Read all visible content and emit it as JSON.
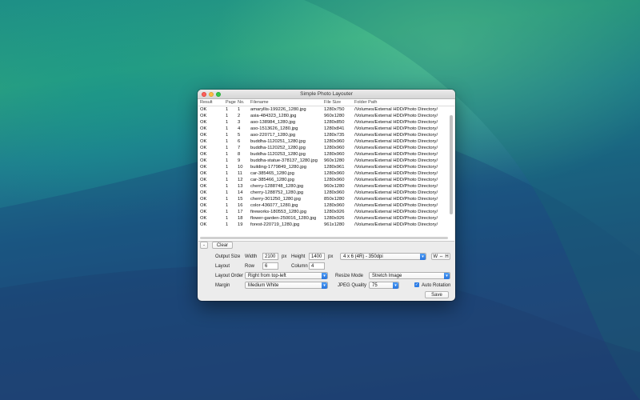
{
  "window": {
    "title": "Simple Photo Layouter"
  },
  "table": {
    "columns": [
      "Result",
      "Page",
      "No.",
      "Filename",
      "File Size",
      "Folder Path"
    ],
    "rows": [
      [
        "OK",
        "1",
        "1",
        "amaryllis-199226_1280.jpg",
        "1280x750",
        "/Volumes/External HDD/Photo Directory/"
      ],
      [
        "OK",
        "1",
        "2",
        "asia-484323_1280.jpg",
        "960x1280",
        "/Volumes/External HDD/Photo Directory/"
      ],
      [
        "OK",
        "1",
        "3",
        "aso-138984_1280.jpg",
        "1280x850",
        "/Volumes/External HDD/Photo Directory/"
      ],
      [
        "OK",
        "1",
        "4",
        "aso-1513626_1280.jpg",
        "1280x841",
        "/Volumes/External HDD/Photo Directory/"
      ],
      [
        "OK",
        "1",
        "5",
        "aso-220717_1280.jpg",
        "1280x735",
        "/Volumes/External HDD/Photo Directory/"
      ],
      [
        "OK",
        "1",
        "6",
        "buddha-1120251_1280.jpg",
        "1280x960",
        "/Volumes/External HDD/Photo Directory/"
      ],
      [
        "OK",
        "1",
        "7",
        "buddha-1120252_1280.jpg",
        "1280x960",
        "/Volumes/External HDD/Photo Directory/"
      ],
      [
        "OK",
        "1",
        "8",
        "buddha-1120253_1280.jpg",
        "1280x960",
        "/Volumes/External HDD/Photo Directory/"
      ],
      [
        "OK",
        "1",
        "9",
        "buddha-statue-378137_1280.jpg",
        "960x1280",
        "/Volumes/External HDD/Photo Directory/"
      ],
      [
        "OK",
        "1",
        "10",
        "building-1779849_1280.jpg",
        "1280x961",
        "/Volumes/External HDD/Photo Directory/"
      ],
      [
        "OK",
        "1",
        "11",
        "car-385465_1280.jpg",
        "1280x960",
        "/Volumes/External HDD/Photo Directory/"
      ],
      [
        "OK",
        "1",
        "12",
        "car-385466_1280.jpg",
        "1280x960",
        "/Volumes/External HDD/Photo Directory/"
      ],
      [
        "OK",
        "1",
        "13",
        "cherry-1288748_1280.jpg",
        "960x1280",
        "/Volumes/External HDD/Photo Directory/"
      ],
      [
        "OK",
        "1",
        "14",
        "cherry-1288752_1280.jpg",
        "1280x960",
        "/Volumes/External HDD/Photo Directory/"
      ],
      [
        "OK",
        "1",
        "15",
        "cherry-301250_1280.jpg",
        "850x1280",
        "/Volumes/External HDD/Photo Directory/"
      ],
      [
        "OK",
        "1",
        "16",
        "color-436077_1280.jpg",
        "1280x960",
        "/Volumes/External HDD/Photo Directory/"
      ],
      [
        "OK",
        "1",
        "17",
        "fireworks-180553_1280.jpg",
        "1280x926",
        "/Volumes/External HDD/Photo Directory/"
      ],
      [
        "OK",
        "1",
        "18",
        "flower-garden-250016_1280.jpg",
        "1280x926",
        "/Volumes/External HDD/Photo Directory/"
      ],
      [
        "OK",
        "1",
        "19",
        "forest-220719_1280.jpg",
        "961x1280",
        "/Volumes/External HDD/Photo Directory/"
      ]
    ]
  },
  "buttons": {
    "minus": "-",
    "clear": "Clear",
    "swap": "W ⇔ H",
    "save": "Save"
  },
  "output_size": {
    "label": "Output Size",
    "width_label": "Width",
    "width": "2100",
    "width_unit": "px",
    "height_label": "Height",
    "height": "1400",
    "height_unit": "px",
    "preset": "4 x 6 (4R) - 350dpi"
  },
  "layout": {
    "label": "Layout",
    "row_label": "Row",
    "row": "6",
    "column_label": "Column",
    "column": "4"
  },
  "layout_order": {
    "label": "Layout Order",
    "value": "Right from top-left"
  },
  "resize_mode": {
    "label": "Resize Mode",
    "value": "Stretch Image"
  },
  "margin": {
    "label": "Margin",
    "value": "Medium White"
  },
  "jpeg_quality": {
    "label": "JPEG Quality",
    "value": "75"
  },
  "auto_rotation": {
    "label": "Auto Rotation",
    "checked": true
  }
}
